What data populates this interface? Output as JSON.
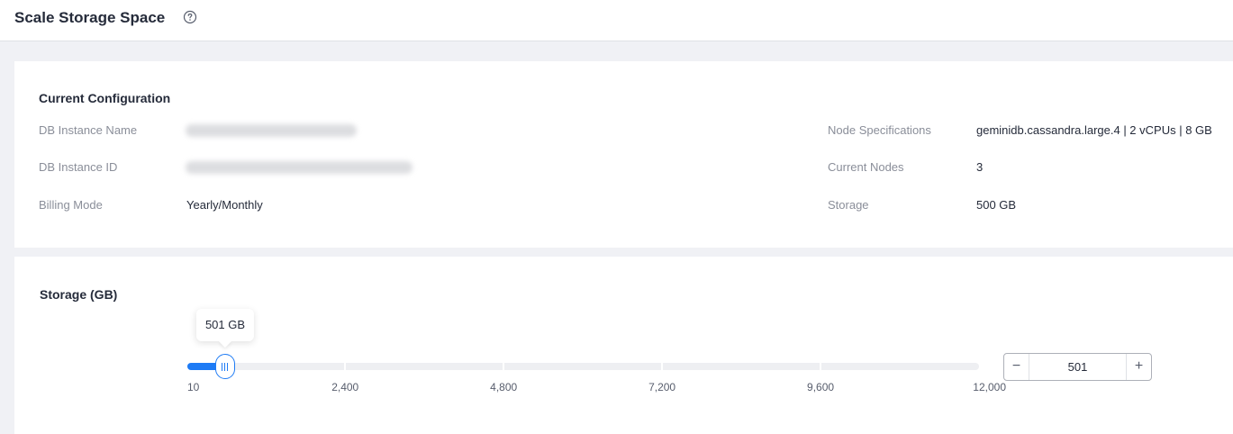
{
  "header": {
    "title": "Scale Storage Space",
    "help_icon": "question-circle-icon"
  },
  "config": {
    "title": "Current Configuration",
    "left": [
      {
        "label": "DB Instance Name",
        "value": ""
      },
      {
        "label": "DB Instance ID",
        "value": ""
      },
      {
        "label": "Billing Mode",
        "value": "Yearly/Monthly"
      }
    ],
    "right": [
      {
        "label": "Node Specifications",
        "value": "geminidb.cassandra.large.4 | 2 vCPUs | 8 GB"
      },
      {
        "label": "Current Nodes",
        "value": "3"
      },
      {
        "label": "Storage",
        "value": "500 GB"
      }
    ]
  },
  "storage": {
    "title": "Storage (GB)",
    "tooltip": "501 GB",
    "slider": {
      "min": 10,
      "max": 12000,
      "value": 501,
      "ticks": [
        "10",
        "2,400",
        "4,800",
        "7,200",
        "9,600",
        "12,000"
      ],
      "tick_values": [
        10,
        2400,
        4800,
        7200,
        9600,
        12000
      ]
    },
    "stepper": {
      "minus": "−",
      "value": "501",
      "plus": "+"
    }
  },
  "colors": {
    "accent": "#1e7bf5",
    "track": "#eeeff2",
    "background": "#f0f1f5"
  }
}
